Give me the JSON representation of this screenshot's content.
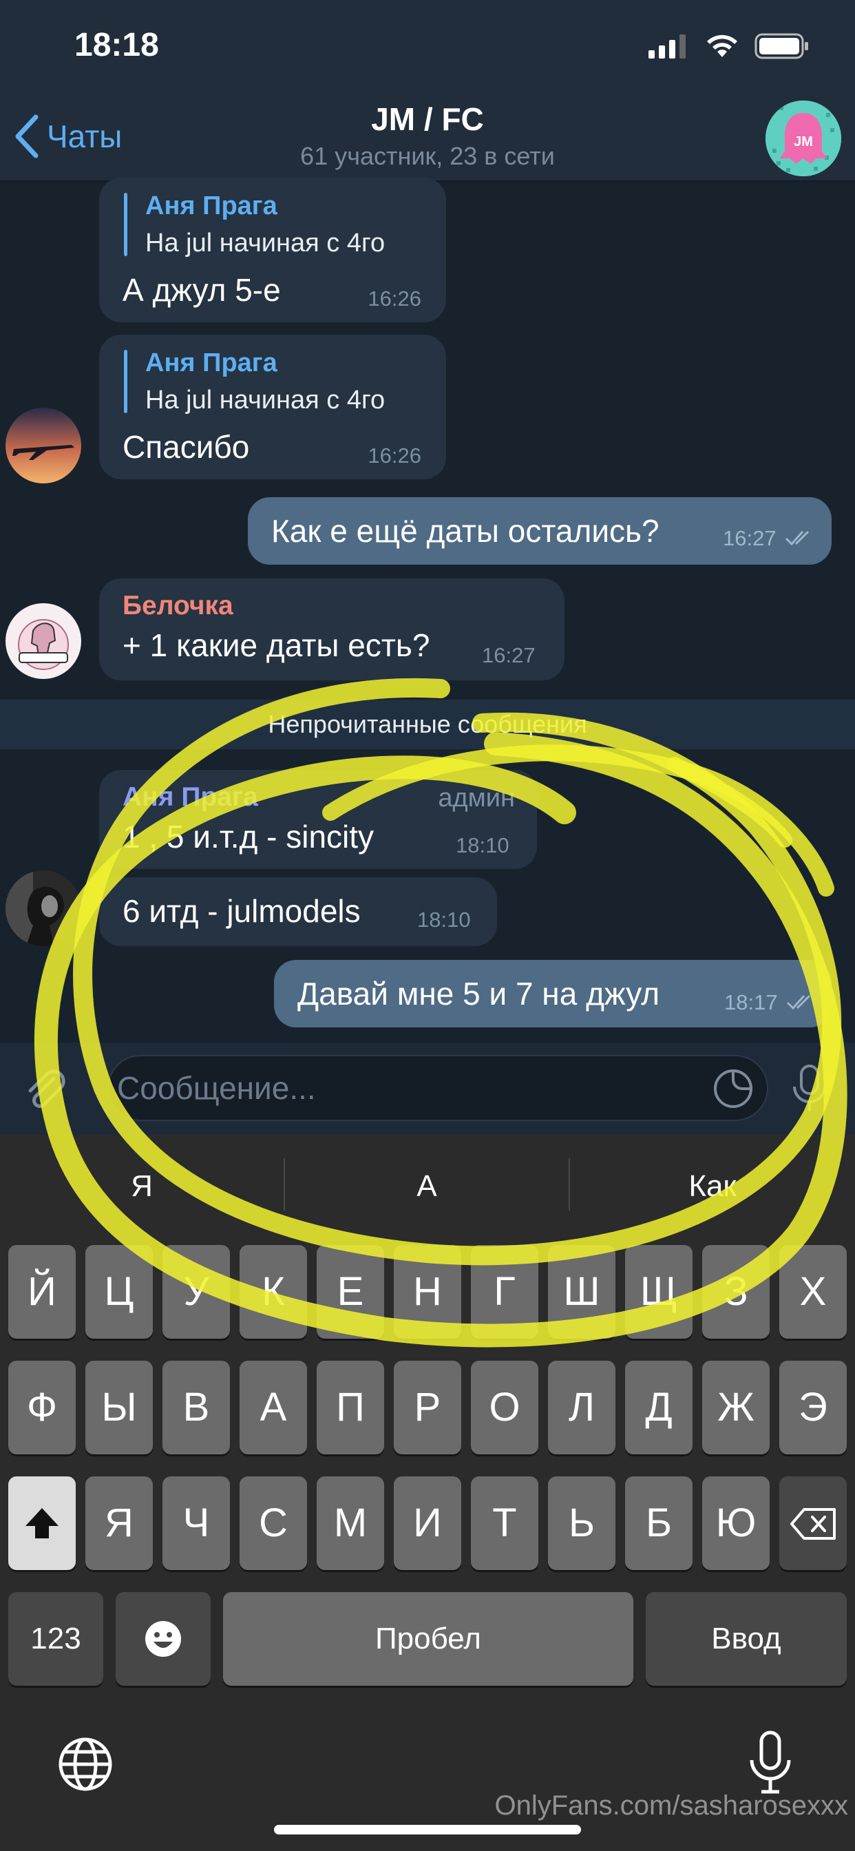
{
  "status_bar": {
    "time": "18:18"
  },
  "nav": {
    "back_label": "Чаты",
    "title": "JM / FC",
    "subtitle": "61 участник, 23 в сети",
    "avatar_text": "JM"
  },
  "messages": [
    {
      "reply_name": "Аня Прага",
      "reply_text": "На jul начиная с 4го",
      "text": "А джул 5-е",
      "time": "16:26"
    },
    {
      "reply_name": "Аня Прага",
      "reply_text": "На jul начиная с 4го",
      "text": "Спасибо",
      "time": "16:26"
    },
    {
      "text": "Как е ещё даты остались?",
      "time": "16:27"
    },
    {
      "sender": "Белочка",
      "text": "+ 1 какие даты есть?",
      "time": "16:27"
    },
    {
      "sender": "Аня Прага",
      "role": "админ",
      "text": "1 , 5 и.т.д - sincity",
      "time": "18:10"
    },
    {
      "text": "6 итд - julmodels",
      "time": "18:10"
    },
    {
      "text": "Давай мне 5 и 7 на джул",
      "time": "18:17"
    }
  ],
  "unread_label": "Непрочитанные сообщения",
  "input": {
    "placeholder": "Сообщение..."
  },
  "keyboard": {
    "suggestions": [
      "Я",
      "А",
      "Как"
    ],
    "row1": [
      "Й",
      "Ц",
      "У",
      "К",
      "Е",
      "Н",
      "Г",
      "Ш",
      "Щ",
      "З",
      "Х"
    ],
    "row2": [
      "Ф",
      "Ы",
      "В",
      "А",
      "П",
      "Р",
      "О",
      "Л",
      "Д",
      "Ж",
      "Э"
    ],
    "row3": [
      "Я",
      "Ч",
      "С",
      "М",
      "И",
      "Т",
      "Ь",
      "Б",
      "Ю"
    ],
    "numbers_label": "123",
    "space_label": "Пробел",
    "return_label": "Ввод"
  },
  "watermark": "OnlyFans.com/sasharosexxx",
  "colors": {
    "accent": "#5eaef1",
    "outgoing_bubble": "#4f6b85",
    "incoming_bubble": "#253342",
    "background": "#18222d",
    "belochka_name": "#f0867a",
    "highlighter": "#f2f230"
  }
}
